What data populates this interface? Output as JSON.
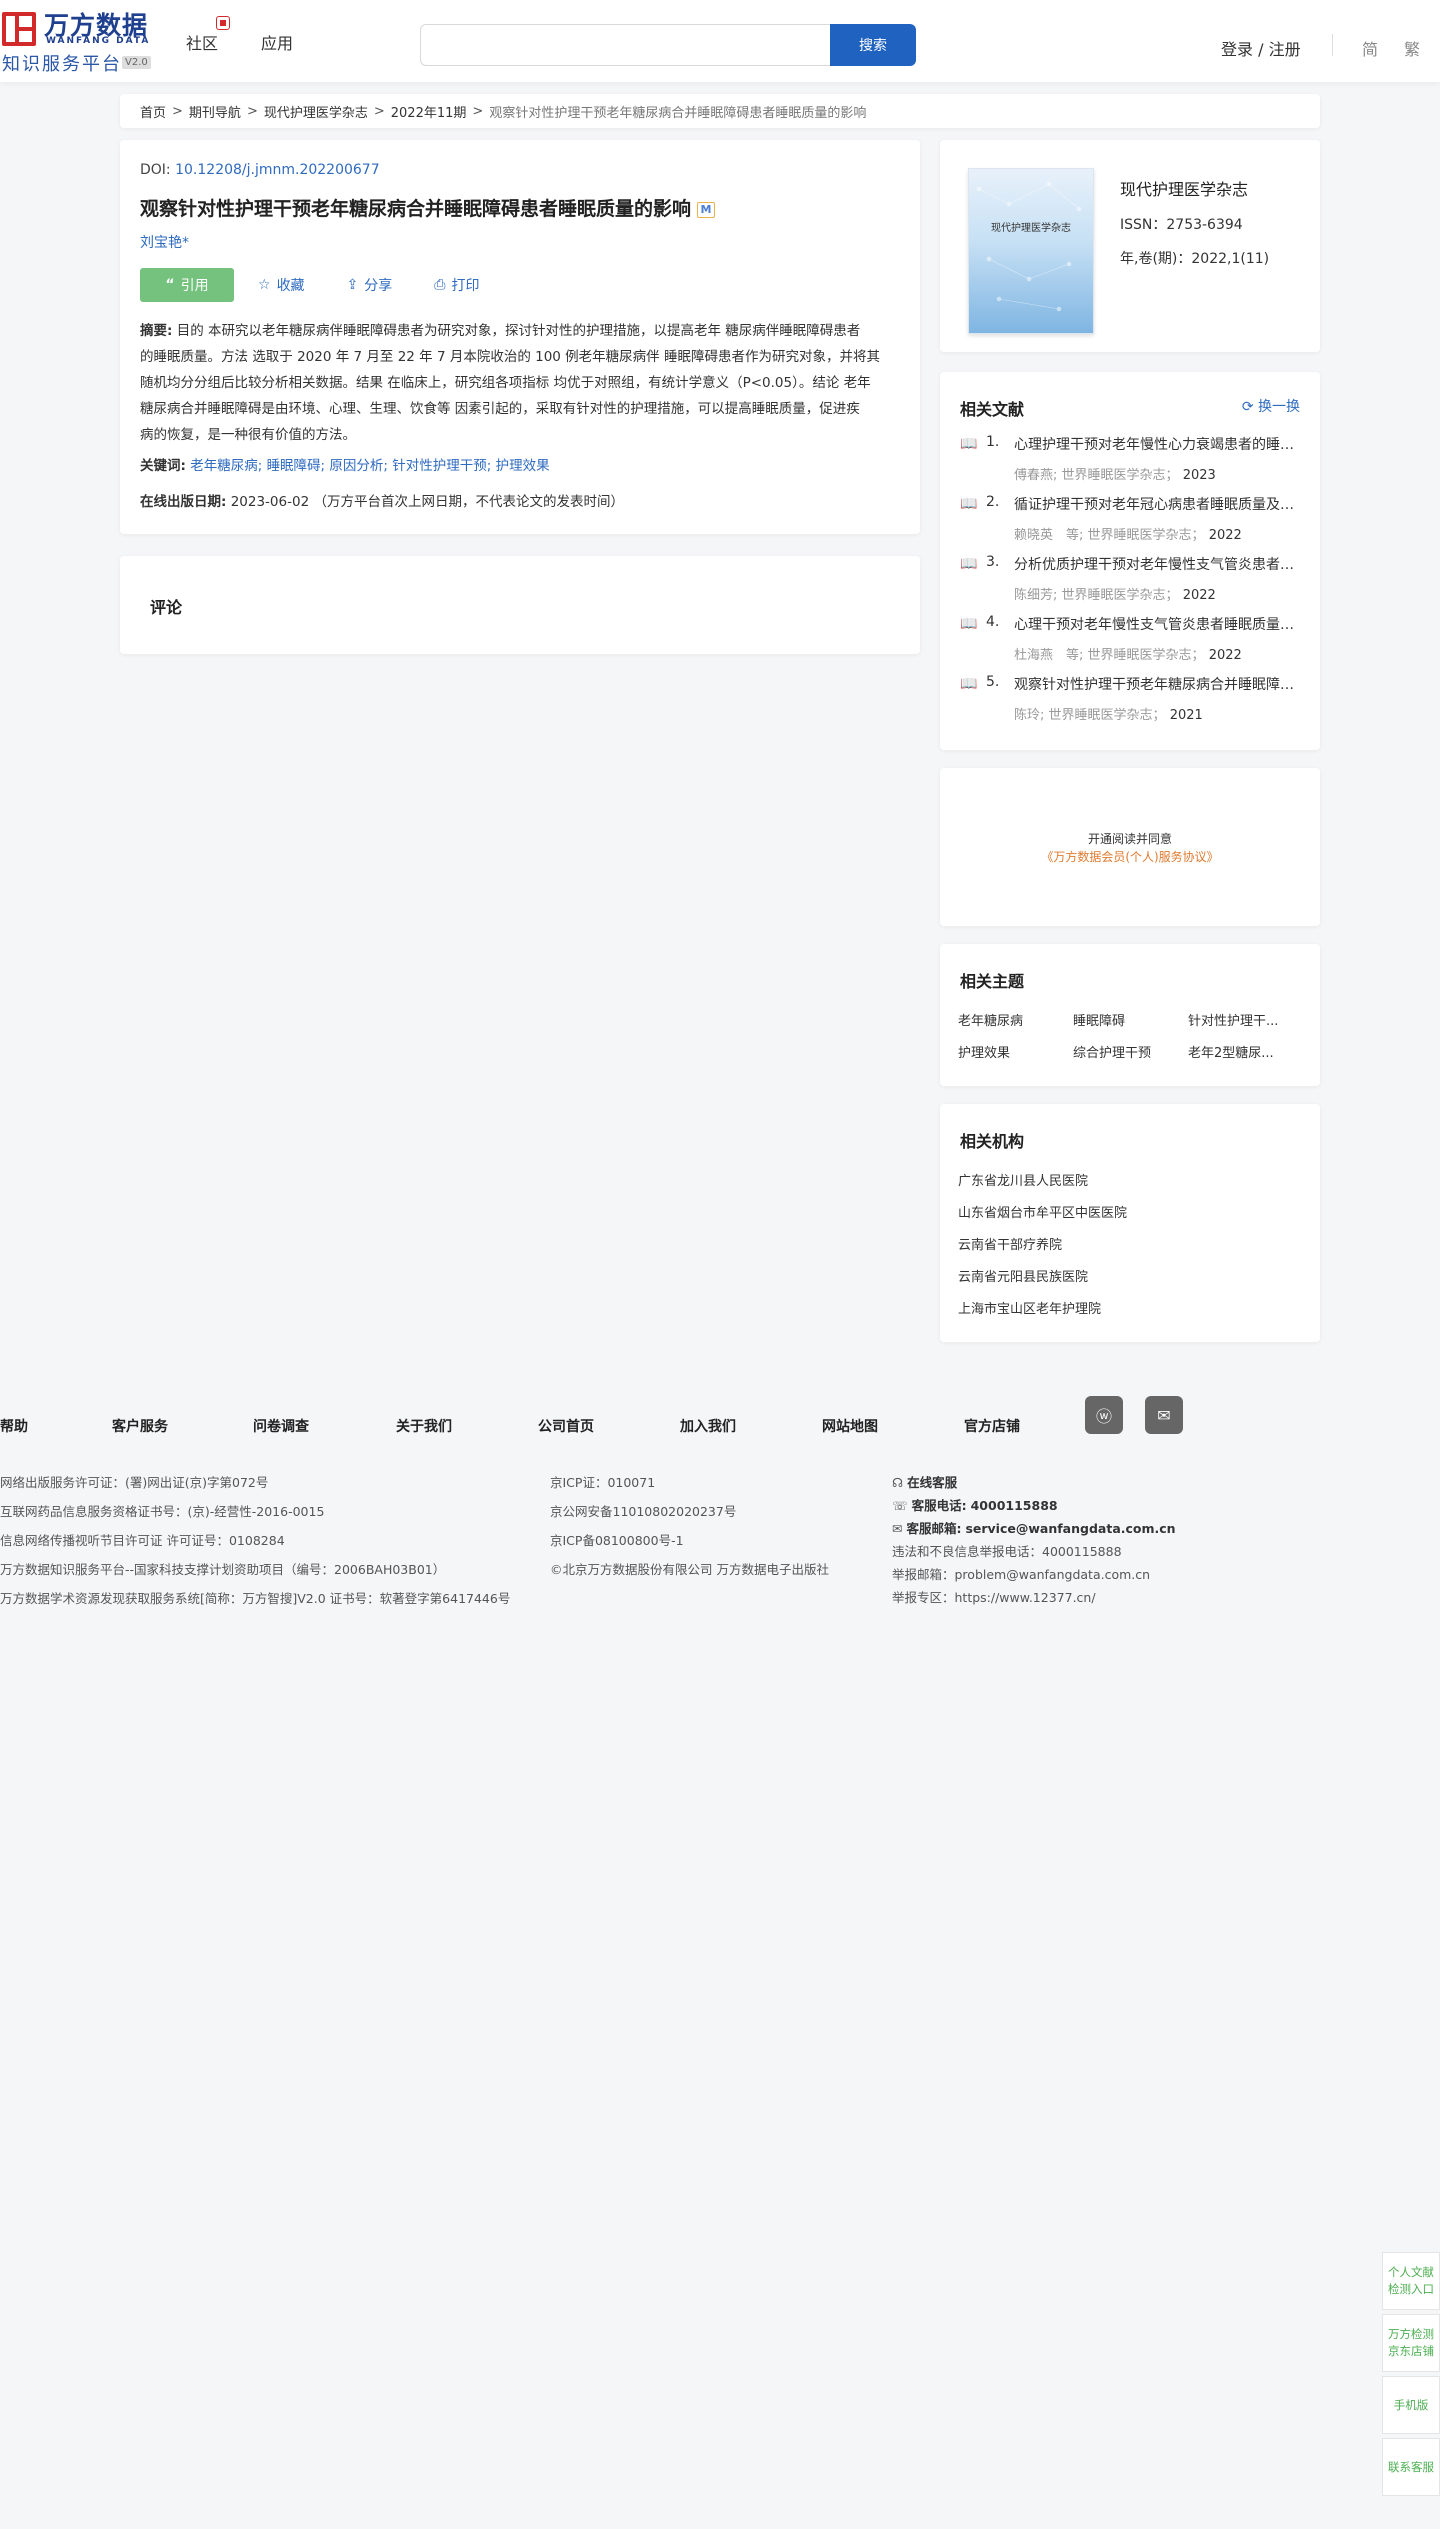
{
  "header": {
    "logo_cn": "万方数据",
    "logo_en": "WANFANG DATA",
    "logo_sub": "知识服务平台",
    "logo_version": "V2.0",
    "nav_community": "社区",
    "nav_apps": "应用",
    "search_placeholder": "",
    "search_button": "搜索",
    "login": "登录 / 注册",
    "lang_simplified": "简",
    "lang_traditional": "繁"
  },
  "breadcrumb": {
    "items": [
      "首页",
      "期刊导航",
      "现代护理医学杂志",
      "2022年11期"
    ],
    "current": "观察针对性护理干预老年糖尿病合并睡眠障碍患者睡眠质量的影响"
  },
  "article": {
    "doi_label": "DOI:",
    "doi": "10.12208/j.jmnm.202200677",
    "title": "观察针对性护理干预老年糖尿病合并睡眠障碍患者睡眠质量的影响",
    "title_badge": "M",
    "author": "刘宝艳*",
    "actions": {
      "cite": "引用",
      "favorite": "收藏",
      "share": "分享",
      "print": "打印"
    },
    "abstract_label": "摘要:",
    "abstract_lines": [
      "目的 本研究以老年糖尿病伴睡眠障碍患者为研究对象，探讨针对性的护理措施，以提高老年 糖尿病伴睡眠障碍患者",
      "的睡眠质量。方法 选取于 2020 年 7 月至 22 年 7 月本院收治的 100 例老年糖尿病伴 睡眠障碍患者作为研究对象，并将其",
      "随机均分分组后比较分析相关数据。结果 在临床上，研究组各项指标 均优于对照组，有统计学意义（P<0.05）。结论 老年",
      "糖尿病合并睡眠障碍是由环境、心理、生理、饮食等 因素引起的，采取有针对性的护理措施，可以提高睡眠质量，促进疾",
      "病的恢复，是一种很有价值的方法。"
    ],
    "keywords_label": "关键词:",
    "keywords": [
      "老年糖尿病;",
      "睡眠障碍;",
      "原因分析;",
      "针对性护理干预;",
      "护理效果"
    ],
    "pubdate_label": "在线出版日期:",
    "pubdate": "2023-06-02",
    "pubdate_note": "（万方平台首次上网日期，不代表论文的发表时间）"
  },
  "comments": {
    "title": "评论"
  },
  "journal": {
    "cover_title": "现代护理医学杂志",
    "name": "现代护理医学杂志",
    "issn": "ISSN：2753-6394",
    "volume": "年,卷(期)：2022,1(11)"
  },
  "related": {
    "title": "相关文献",
    "refresh": "换一换",
    "items": [
      {
        "num": "1.",
        "title": "心理护理干预对老年慢性心力衰竭患者的睡眠质量的影响",
        "authors": "傅春燕;",
        "venue": "世界睡眠医学杂志；",
        "year": "2023"
      },
      {
        "num": "2.",
        "title": "循证护理干预对老年冠心病患者睡眠质量及生活质量的影响",
        "authors": "赖晓英　等;",
        "venue": "世界睡眠医学杂志；",
        "year": "2022"
      },
      {
        "num": "3.",
        "title": "分析优质护理干预对老年慢性支气管炎患者睡眠质量的影响",
        "authors": "陈细芳;",
        "venue": "世界睡眠医学杂志；",
        "year": "2022"
      },
      {
        "num": "4.",
        "title": "心理干预对老年慢性支气管炎患者睡眠质量的影响研究",
        "authors": "杜海燕　等;",
        "venue": "世界睡眠医学杂志；",
        "year": "2022"
      },
      {
        "num": "5.",
        "title": "观察针对性护理干预老年糖尿病合并睡眠障碍患者睡眠质量",
        "authors": "陈玲;",
        "venue": "世界睡眠医学杂志；",
        "year": "2021"
      }
    ]
  },
  "promo": {
    "line1": "开通阅读并同意",
    "line2": "《万方数据会员(个人)服务协议》"
  },
  "topics": {
    "title": "相关主题",
    "items": [
      "老年糖尿病",
      "睡眠障碍",
      "针对性护理干...",
      "护理效果",
      "综合护理干预",
      "老年2型糖尿..."
    ]
  },
  "institutions": {
    "title": "相关机构",
    "items": [
      "广东省龙川县人民医院",
      "山东省烟台市牟平区中医医院",
      "云南省干部疗养院",
      "云南省元阳县民族医院",
      "上海市宝山区老年护理院"
    ]
  },
  "footer": {
    "nav": [
      "帮助",
      "客户服务",
      "问卷调查",
      "关于我们",
      "公司首页",
      "加入我们",
      "网站地图",
      "官方店铺"
    ],
    "col1": [
      "网络出版服务许可证：(署)网出证(京)字第072号",
      "互联网药品信息服务资格证书号：(京)-经营性-2016-0015",
      "信息网络传播视听节目许可证 许可证号：0108284",
      "万方数据知识服务平台--国家科技支撑计划资助项目（编号：2006BAH03B01）",
      "万方数据学术资源发现获取服务系统[简称：万方智搜]V2.0 证书号：软著登字第6417446号"
    ],
    "col2": [
      "京ICP证：010071",
      "京公网安备11010802020237号",
      "京ICP备08100800号-1",
      "©北京万方数据股份有限公司 万方数据电子出版社"
    ],
    "online_service": "在线客服",
    "phone_label": "客服电话:",
    "phone": "4000115888",
    "email_label": "客服邮箱:",
    "email": "service@wanfangdata.com.cn",
    "report_phone": "违法和不良信息举报电话：4000115888",
    "report_email": "举报邮箱：problem@wanfangdata.com.cn",
    "report_zone": "举报专区：https://www.12377.cn/"
  },
  "float_buttons": [
    "个人文献检测入口",
    "万方检测京东店铺",
    "手机版",
    "联系客服"
  ]
}
